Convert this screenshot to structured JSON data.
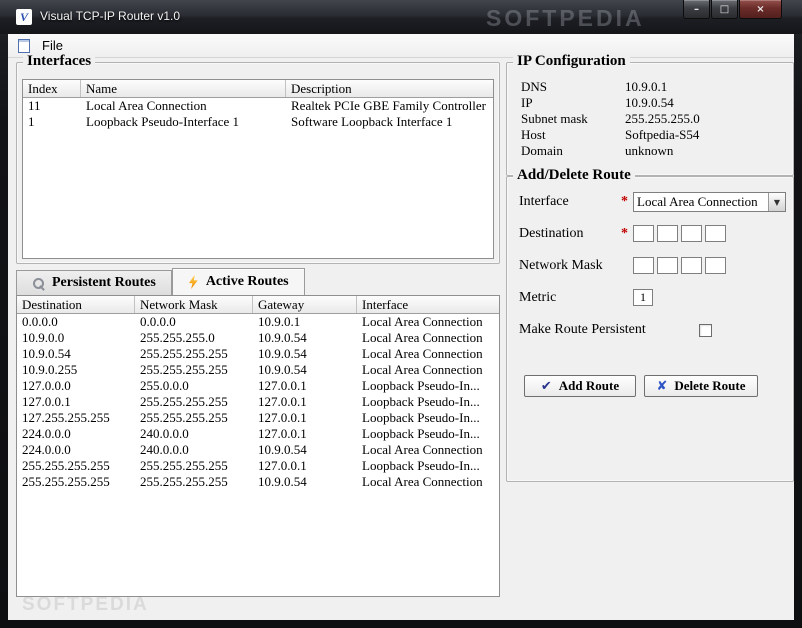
{
  "window": {
    "title": "Visual TCP-IP Router v1.0",
    "logo_glyph": "V",
    "watermark": "SOFTPEDIA",
    "controls": {
      "minimize_glyph": "–",
      "maximize_glyph": "□",
      "close_glyph": "×"
    }
  },
  "menu": {
    "file": "File"
  },
  "interfaces": {
    "title": "Interfaces",
    "columns": [
      "Index",
      "Name",
      "Description"
    ],
    "rows": [
      [
        "11",
        "Local Area Connection",
        "Realtek PCIe GBE Family Controller"
      ],
      [
        "1",
        "Loopback Pseudo-Interface 1",
        "Software Loopback Interface 1"
      ]
    ]
  },
  "routes": {
    "tabs": [
      {
        "label": "Persistent Routes",
        "icon": "magnifier-icon"
      },
      {
        "label": "Active Routes",
        "icon": "lightning-icon"
      }
    ],
    "columns": [
      "Destination",
      "Network Mask",
      "Gateway",
      "Interface"
    ],
    "rows": [
      [
        "0.0.0.0",
        "0.0.0.0",
        "10.9.0.1",
        "Local Area Connection"
      ],
      [
        "10.9.0.0",
        "255.255.255.0",
        "10.9.0.54",
        "Local Area Connection"
      ],
      [
        "10.9.0.54",
        "255.255.255.255",
        "10.9.0.54",
        "Local Area Connection"
      ],
      [
        "10.9.0.255",
        "255.255.255.255",
        "10.9.0.54",
        "Local Area Connection"
      ],
      [
        "127.0.0.0",
        "255.0.0.0",
        "127.0.0.1",
        "Loopback Pseudo-In..."
      ],
      [
        "127.0.0.1",
        "255.255.255.255",
        "127.0.0.1",
        "Loopback Pseudo-In..."
      ],
      [
        "127.255.255.255",
        "255.255.255.255",
        "127.0.0.1",
        "Loopback Pseudo-In..."
      ],
      [
        "224.0.0.0",
        "240.0.0.0",
        "127.0.0.1",
        "Loopback Pseudo-In..."
      ],
      [
        "224.0.0.0",
        "240.0.0.0",
        "10.9.0.54",
        "Local Area Connection"
      ],
      [
        "255.255.255.255",
        "255.255.255.255",
        "127.0.0.1",
        "Loopback Pseudo-In..."
      ],
      [
        "255.255.255.255",
        "255.255.255.255",
        "10.9.0.54",
        "Local Area Connection"
      ]
    ]
  },
  "ip_configuration": {
    "title": "IP Configuration",
    "fields": [
      {
        "label": "DNS",
        "value": "10.9.0.1"
      },
      {
        "label": "IP",
        "value": "10.9.0.54"
      },
      {
        "label": "Subnet mask",
        "value": "255.255.255.0"
      },
      {
        "label": "Host",
        "value": "Softpedia-S54"
      },
      {
        "label": "Domain",
        "value": "unknown"
      }
    ]
  },
  "add_delete_route": {
    "title": "Add/Delete Route",
    "required_marker": "*",
    "interface": {
      "label": "Interface",
      "value": "Local Area Connection"
    },
    "destination": {
      "label": "Destination"
    },
    "network_mask": {
      "label": "Network Mask"
    },
    "metric": {
      "label": "Metric",
      "value": "1"
    },
    "persistent": {
      "label": "Make Route Persistent",
      "checked": false
    },
    "buttons": {
      "add": "Add Route",
      "delete": "Delete Route"
    },
    "icons": {
      "add": "✔",
      "delete": "✘",
      "dropdown": "▼"
    }
  }
}
